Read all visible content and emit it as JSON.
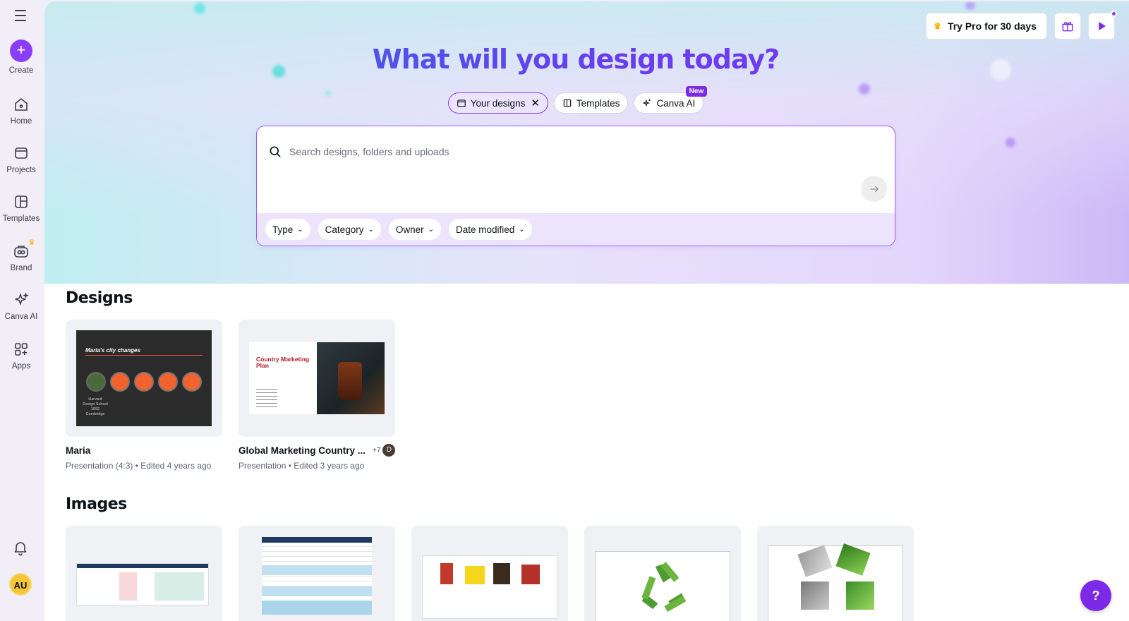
{
  "sidebar": {
    "create_label": "Create",
    "items": [
      {
        "label": "Home",
        "icon": "home-icon"
      },
      {
        "label": "Projects",
        "icon": "folder-icon"
      },
      {
        "label": "Templates",
        "icon": "templates-icon"
      },
      {
        "label": "Brand",
        "icon": "brand-icon"
      },
      {
        "label": "Canva AI",
        "icon": "sparkle-icon"
      },
      {
        "label": "Apps",
        "icon": "apps-icon"
      }
    ],
    "avatar_initials": "AU"
  },
  "header": {
    "title": "What will you design today?",
    "pro_label": "Try Pro for 30 days"
  },
  "search_tabs": [
    {
      "label": "Your designs",
      "active": true
    },
    {
      "label": "Templates",
      "active": false
    },
    {
      "label": "Canva AI",
      "active": false,
      "badge": "New"
    }
  ],
  "search": {
    "placeholder": "Search designs, folders and uploads",
    "filters": [
      "Type",
      "Category",
      "Owner",
      "Date modified"
    ]
  },
  "designs": {
    "section_title": "Designs",
    "items": [
      {
        "name": "Maria",
        "meta": "Presentation (4:3) • Edited 4 years ago",
        "thumb_title": "Maria's city changes",
        "thumb_caption": "Harvard Design School 1992 Cambridge"
      },
      {
        "name": "Global Marketing Country ...",
        "meta": "Presentation • Edited 3 years ago",
        "collab_count": "+7",
        "collab_initial": "D",
        "thumb_title": "Country Marketing Plan"
      }
    ]
  },
  "images": {
    "section_title": "Images"
  },
  "help_label": "?",
  "colors": {
    "accent": "#8b3dff",
    "badge": "#7d2ae8"
  }
}
